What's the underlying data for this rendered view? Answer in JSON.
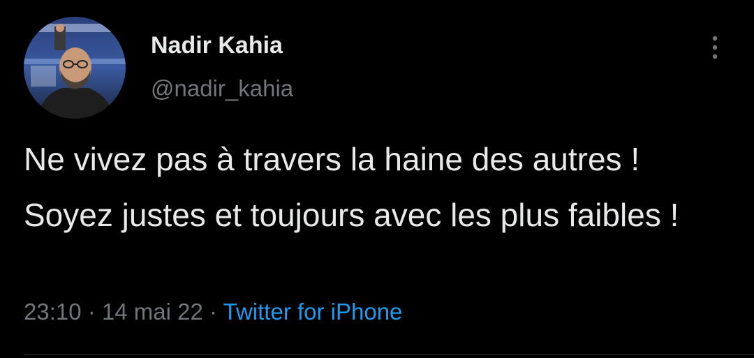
{
  "tweet": {
    "author": {
      "name": "Nadir Kahia",
      "handle": "@nadir_kahia"
    },
    "text": "Ne vivez pas à travers la haine des autres ! Soyez justes et toujours avec les plus faibles !",
    "meta": {
      "time": "23:10",
      "separator": "·",
      "date": "14 mai 22",
      "source": "Twitter for iPhone"
    },
    "icons": {
      "more": "more-vertical-icon",
      "avatar": "avatar"
    },
    "colors": {
      "background": "#000000",
      "text": "#e7e9ea",
      "secondary": "#71767b",
      "accent": "#1d9bf0"
    }
  }
}
